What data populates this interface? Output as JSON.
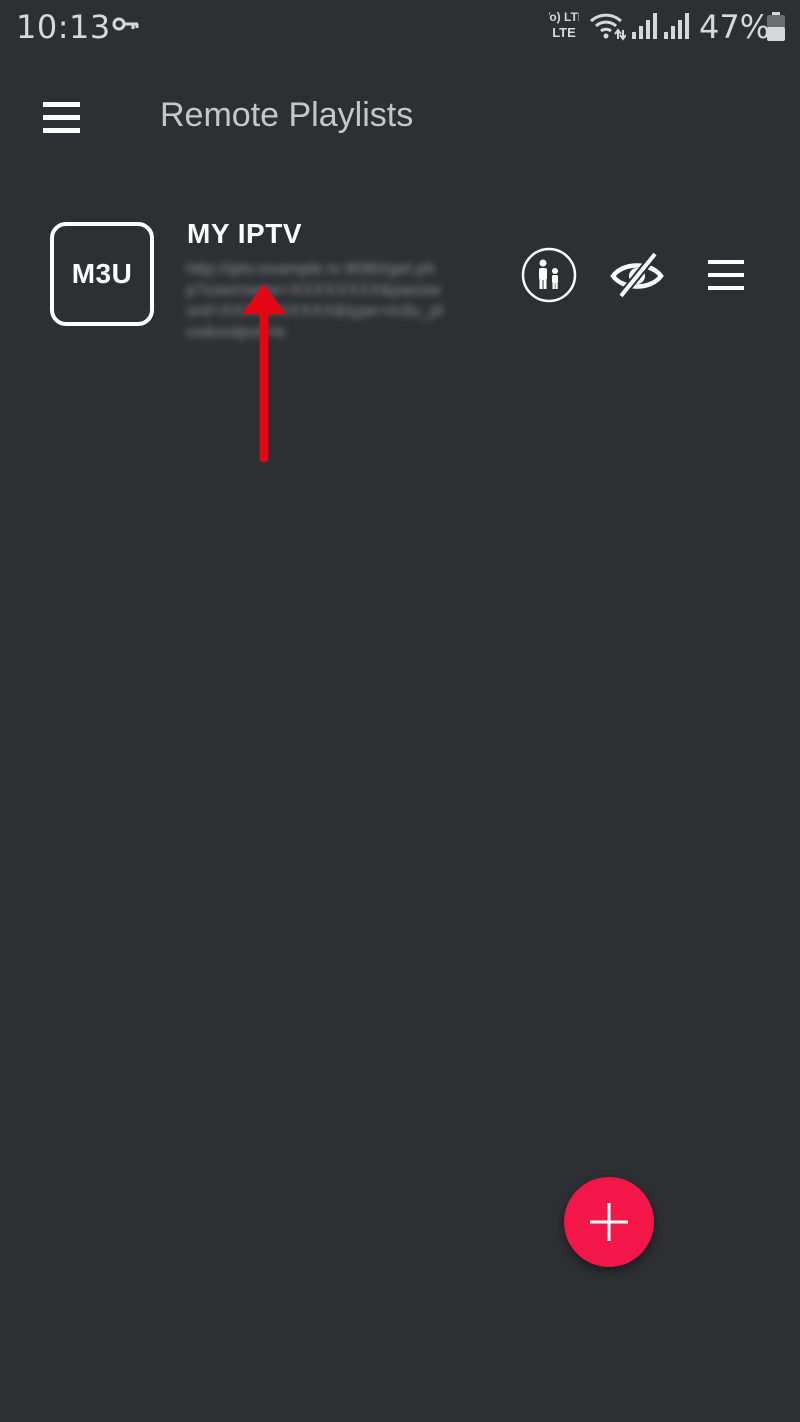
{
  "status_bar": {
    "time": "10:13",
    "battery_percent": "47%",
    "network_label": "Vo) LTE",
    "icons": [
      "key-icon",
      "volte-icon",
      "wifi-icon",
      "signal-icon",
      "signal-icon",
      "battery-icon"
    ]
  },
  "app_bar": {
    "title": "Remote Playlists",
    "menu_icon": "hamburger-icon"
  },
  "playlists": [
    {
      "logo_text": "M3U",
      "name": "MY IPTV",
      "url": "http://iptv.example.tv:8080/get.php?username=XXXXXXXX&password=XXXXXXXXXX&type=m3u_plus&output=ts"
    }
  ],
  "row_actions": [
    "parental-control-icon",
    "eye-off-icon",
    "menu-icon"
  ],
  "fab": {
    "icon": "plus-icon",
    "color": "#f31648"
  },
  "annotation": {
    "icon": "arrow-up-icon",
    "color": "#e30613"
  },
  "colors": {
    "background": "#2e2f33",
    "title_text": "#c7c7c9"
  }
}
